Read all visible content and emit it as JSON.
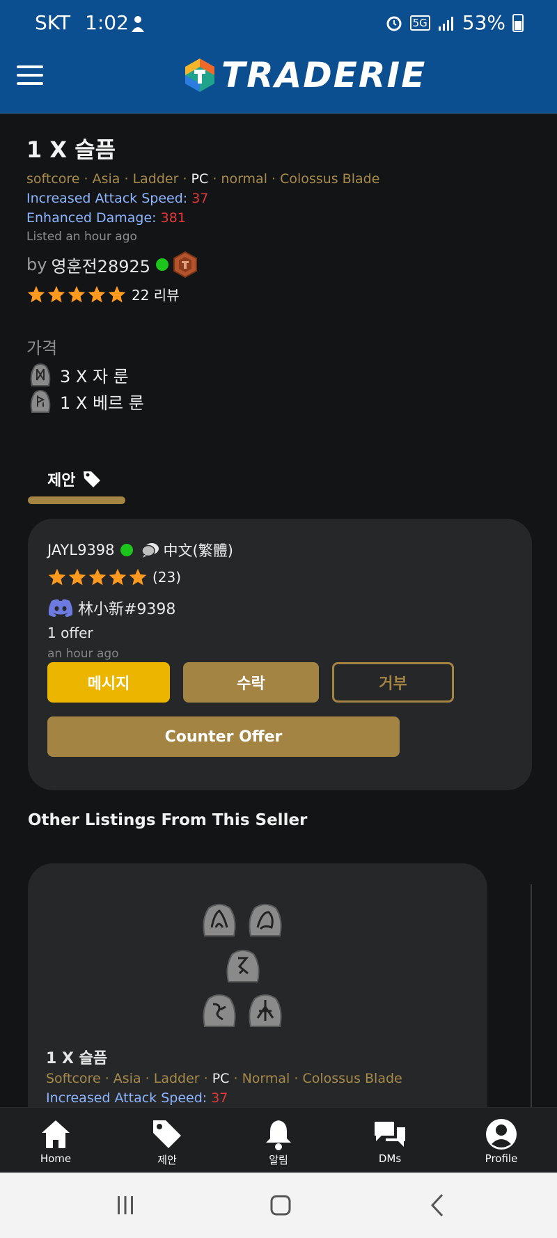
{
  "status_bar": {
    "carrier": "SKT",
    "time": "1:02",
    "network": "5G",
    "battery": "53%"
  },
  "header": {
    "logo_text": "TRADERIE"
  },
  "listing": {
    "title": "1 X 슬픔",
    "meta": {
      "mode": "softcore",
      "region": "Asia",
      "ladder": "Ladder",
      "platform": "PC",
      "difficulty": "normal",
      "base": "Colossus Blade"
    },
    "attributes": [
      {
        "name": "Increased Attack Speed:",
        "value": "37"
      },
      {
        "name": "Enhanced Damage:",
        "value": "381"
      }
    ],
    "listed": "Listed an hour ago",
    "seller": {
      "by": "by",
      "name": "영훈전28925",
      "reviews": "22 리뷰",
      "rating": 5
    }
  },
  "price": {
    "label": "가격",
    "items": [
      {
        "text": "3 X 자 룬"
      },
      {
        "text": "1 X 베르 룬"
      }
    ]
  },
  "tab": {
    "label": "제안"
  },
  "offer": {
    "user": "JAYL9398",
    "language": "中文(繁體)",
    "rating": 5,
    "review_count": "(23)",
    "discord": "林小新#9398",
    "count": "1 offer",
    "time": "an hour ago",
    "buttons": {
      "message": "메시지",
      "accept": "수락",
      "decline": "거부",
      "counter": "Counter Offer"
    }
  },
  "other_listings": {
    "title": "Other Listings From This Seller",
    "card": {
      "title": "1 X 슬픔",
      "meta": {
        "mode": "Softcore",
        "region": "Asia",
        "ladder": "Ladder",
        "platform": "PC",
        "difficulty": "Normal",
        "base": "Colossus Blade"
      },
      "attribute": {
        "name": "Increased Attack Speed:",
        "value": "37"
      }
    }
  },
  "bottom_nav": [
    {
      "label": "Home",
      "icon": "home-icon"
    },
    {
      "label": "제안",
      "icon": "tag-icon"
    },
    {
      "label": "알림",
      "icon": "bell-icon"
    },
    {
      "label": "DMs",
      "icon": "chat-icon"
    },
    {
      "label": "Profile",
      "icon": "profile-icon"
    }
  ],
  "colors": {
    "header": "#0c4f91",
    "gold": "#a38443",
    "yellow": "#ebb500",
    "blue_attr": "#8db4ff",
    "red_value": "#e23a3a",
    "star": "#ff9a1f",
    "online": "#1cc41c"
  }
}
